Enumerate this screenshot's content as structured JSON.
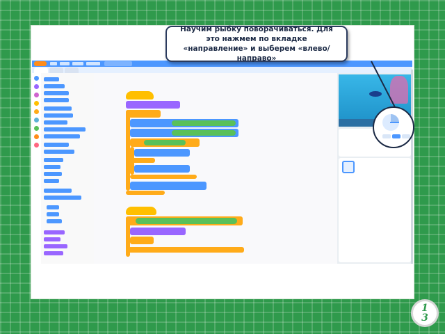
{
  "slide": {
    "callout_text": "Научим рыбку поворачиваться. Для это нажмем по вкладке «направление» и выберем «влево/направо»",
    "page_number_top": "1",
    "page_number_bottom": "3"
  },
  "icons": {
    "magnifier": "magnifier-circle",
    "direction_dial": "direction-dial-icon",
    "fish_sprite": "fish-icon"
  },
  "colors": {
    "background_green": "#2f9a4c",
    "scratch_blue": "#4c97ff",
    "motion_block": "#4c97ff",
    "control_block": "#ffab19",
    "events_block": "#ffbf00",
    "operators_block": "#59c059",
    "looks_block": "#9966ff",
    "callout_border": "#2b3b5e"
  }
}
